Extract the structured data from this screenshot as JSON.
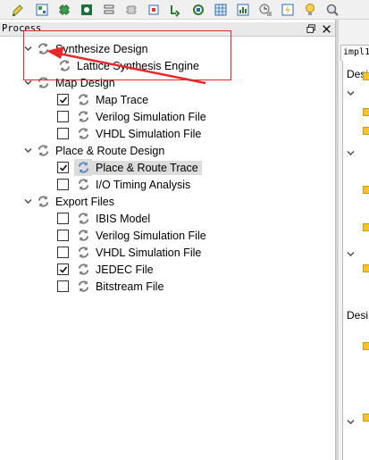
{
  "toolbar": {
    "icons": [
      "edit-icon",
      "layout-icon",
      "chip-icon",
      "inspect-icon",
      "list-icon",
      "cpu-gray-icon",
      "chip-blue-icon",
      "routing-icon",
      "module-icon",
      "grid-icon",
      "bars-icon",
      "clock-chip-icon",
      "bolt-icon",
      "bulb-icon",
      "zoom-icon"
    ]
  },
  "process_panel": {
    "title": "Process",
    "float_icon": "float-window-icon",
    "close_icon": "close-icon"
  },
  "tree": {
    "groups": [
      {
        "label": "Synthesize Design",
        "children": [
          {
            "label": "Lattice Synthesis Engine",
            "checkbox": null
          }
        ]
      },
      {
        "label": "Map Design",
        "children": [
          {
            "label": "Map Trace",
            "checkbox": true
          },
          {
            "label": "Verilog Simulation File",
            "checkbox": false
          },
          {
            "label": "VHDL Simulation File",
            "checkbox": false
          }
        ]
      },
      {
        "label": "Place & Route Design",
        "children": [
          {
            "label": "Place & Route Trace",
            "checkbox": true,
            "selected": true
          },
          {
            "label": "I/O Timing Analysis",
            "checkbox": false
          }
        ]
      },
      {
        "label": "Export Files",
        "children": [
          {
            "label": "IBIS Model",
            "checkbox": false
          },
          {
            "label": "Verilog Simulation File",
            "checkbox": false
          },
          {
            "label": "VHDL Simulation File",
            "checkbox": false
          },
          {
            "label": "JEDEC File",
            "checkbox": true
          },
          {
            "label": "Bitstream File",
            "checkbox": false
          }
        ]
      }
    ]
  },
  "right_panel": {
    "tab_label": "impl1",
    "section_heads": [
      "Desig",
      "Desi"
    ]
  },
  "annotation": {
    "color": "#e8292b"
  },
  "colors": {
    "sync_icon": "#7a7a7a",
    "folder_accent": "#f4c430",
    "selection_bg": "#dcdcdc"
  }
}
